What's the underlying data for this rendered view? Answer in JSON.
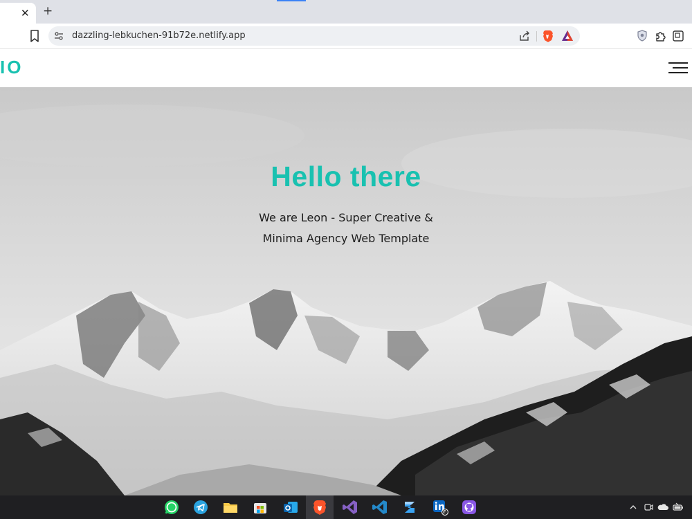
{
  "browser": {
    "tab_close_glyph": "✕",
    "new_tab_glyph": "+",
    "url": "dazzling-lebkuchen-91b72e.netlify.app"
  },
  "site": {
    "logo": "IO",
    "hero": {
      "title": "Hello there",
      "subtitle_line1": "We are Leon - Super Creative &",
      "subtitle_line2": "Minima Agency Web Template"
    }
  },
  "colors": {
    "accent": "#19c1b0",
    "taskbar": "#1f1f22"
  },
  "taskbar": {
    "icons": [
      "whatsapp-icon",
      "telegram-icon",
      "file-explorer-icon",
      "microsoft-store-icon",
      "outlook-icon",
      "brave-icon",
      "visual-studio-icon",
      "vscode-icon",
      "zed-icon",
      "linkedin-icon",
      "github-icon"
    ],
    "tray": [
      "chevron-up-icon",
      "meet-icon",
      "onedrive-icon",
      "battery-icon"
    ]
  }
}
